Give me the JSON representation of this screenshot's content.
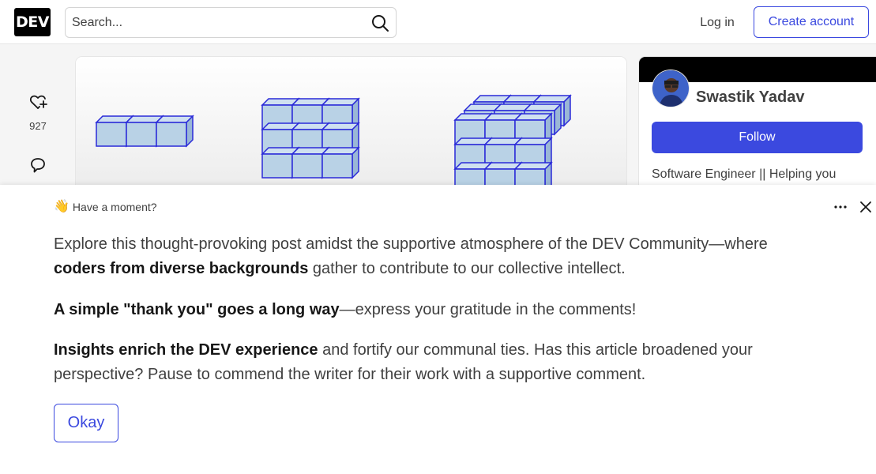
{
  "header": {
    "logo_text": "DEV",
    "search_placeholder": "Search...",
    "login_label": "Log in",
    "create_account_label": "Create account",
    "accent_color": "#3b49df"
  },
  "reactions": {
    "heart_icon": "heart-plus-icon",
    "heart_count": "927",
    "comment_icon": "comment-icon"
  },
  "article": {
    "cover_description_icon": "cube-stack-illustration"
  },
  "author": {
    "name": "Swastik Yadav",
    "follow_label": "Follow",
    "bio": "Software Engineer || Helping you"
  },
  "modal": {
    "wave_emoji": "👋",
    "title": "Have a moment?",
    "p1": {
      "part1": "Explore this thought-provoking post amidst the supportive atmosphere of the DEV Community—where ",
      "bold": "coders from diverse backgrounds",
      "part2": " gather to contribute to our collective intellect."
    },
    "p2": {
      "bold": "A simple \"thank you\" goes a long way",
      "part2": "—express your gratitude in the comments!"
    },
    "p3": {
      "bold": "Insights enrich the DEV experience",
      "part2": " and fortify our communal ties. Has this article broadened your perspective? Pause to commend the writer for their work with a supportive comment."
    },
    "okay_label": "Okay"
  }
}
